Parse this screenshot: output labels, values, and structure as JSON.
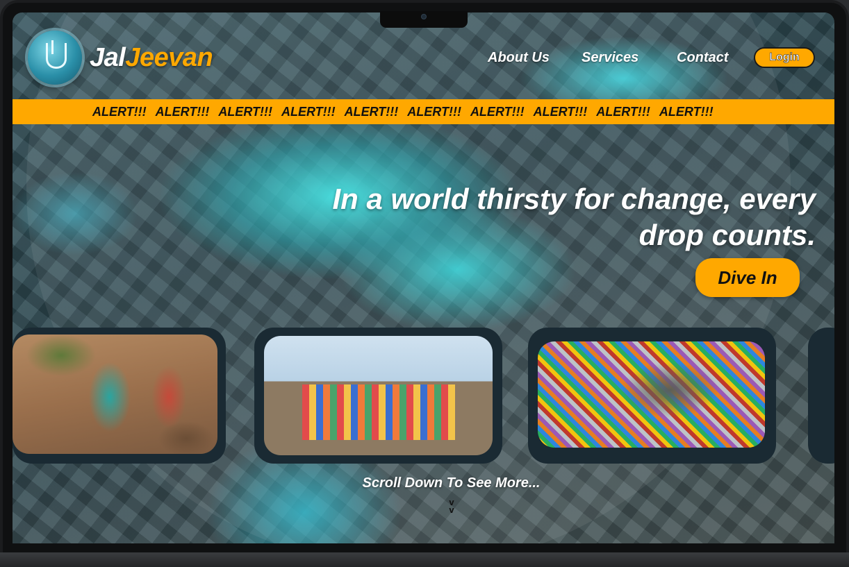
{
  "brand": {
    "part1": "Jal",
    "part2": "Jeevan",
    "logo_icon": "water-tap-icon"
  },
  "nav": {
    "links": [
      "About Us",
      "Services",
      "Contact"
    ],
    "login": "Login"
  },
  "alert_bar": {
    "items": [
      "ALERT!!!",
      "ALERT!!!",
      "ALERT!!!",
      "ALERT!!!",
      "ALERT!!!",
      "ALERT!!!",
      "ALERT!!!",
      "ALERT!!!",
      "ALERT!!!",
      "ALERT!!!"
    ],
    "color": "#ffa800"
  },
  "hero": {
    "headline": "In a world thirsty for change, every drop counts.",
    "cta": "Dive In"
  },
  "gallery": {
    "cards": [
      {
        "icon": "photo-women-carrying-water-icon"
      },
      {
        "icon": "photo-women-line-water-pots-icon"
      },
      {
        "icon": "photo-crowd-around-well-icon"
      }
    ]
  },
  "scroll_hint": {
    "text": "Scroll Down To See More...",
    "glyph": "v"
  },
  "colors": {
    "accent": "#ffa800",
    "card": "#1a2a33",
    "text": "#ffffff"
  }
}
